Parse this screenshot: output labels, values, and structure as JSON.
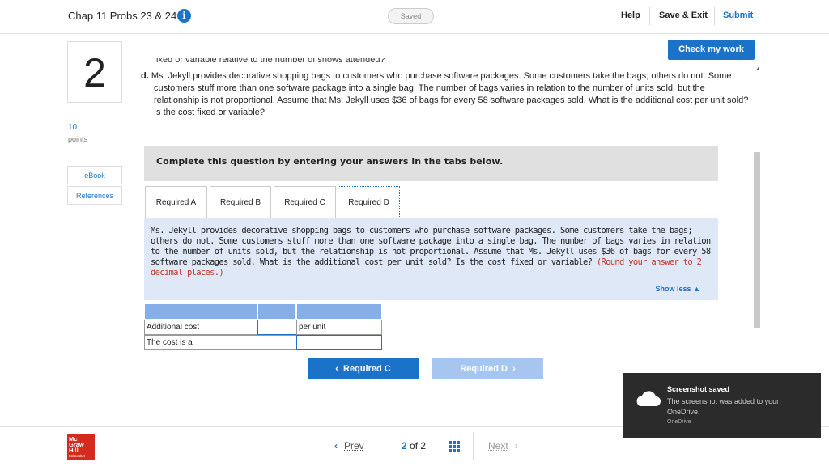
{
  "header": {
    "assignment_title": "Chap 11 Probs 23 & 24",
    "info_icon": "info-icon",
    "saved_status": "Saved",
    "help": "Help",
    "save_exit": "Save & Exit",
    "submit": "Submit",
    "check_my_work": "Check my work"
  },
  "question": {
    "number": "2",
    "points_value": "10",
    "points_label": "points",
    "ebook": "eBook",
    "references": "References",
    "cut_off_text": "fixed or variable relative to the number of shows attended?",
    "part_label": "d.",
    "part_text": "Ms. Jekyll provides decorative shopping bags to customers who purchase software packages. Some customers take the bags; others do not. Some customers stuff more than one software package into a single bag. The number of bags varies in relation to the number of units sold, but the relationship is not proportional. Assume that Ms. Jekyll uses $36 of bags for every 58 software packages sold. What is the additional cost per unit sold? Is the cost fixed or variable?"
  },
  "answer_area": {
    "instruction": "Complete this question by entering your answers in the tabs below.",
    "tabs": [
      "Required A",
      "Required B",
      "Required C",
      "Required D"
    ],
    "active_tab": "Required D",
    "panel_text": "Ms. Jekyll provides decorative shopping bags to customers who purchase software packages. Some customers take the bags; others do not. Some customers stuff more than one software package into a single bag. The number of bags varies in relation to the number of units sold, but the relationship is not proportional. Assume that Ms. Jekyll uses $36 of bags for every 58 software packages sold. What is the additional cost per unit sold? Is the cost fixed or variable?",
    "panel_note": "(Round your answer to 2 decimal places.)",
    "show_less": "Show less",
    "rows": [
      {
        "label": "Additional cost",
        "value": "",
        "unit": "per unit"
      },
      {
        "label": "The cost is a",
        "value": ""
      }
    ],
    "prev_tab_button": "Required C",
    "next_tab_button": "Required D"
  },
  "footer": {
    "logo_lines": [
      "Mc",
      "Graw",
      "Hill",
      "Education"
    ],
    "prev": "Prev",
    "current_page": "2",
    "of": "of",
    "total_pages": "2",
    "next": "Next"
  },
  "toast": {
    "title": "Screenshot saved",
    "body": "The screenshot was added to your OneDrive.",
    "source": "OneDrive",
    "icon": "cloud-icon"
  },
  "colors": {
    "accent": "#1a73c9",
    "disabled_accent": "#a6c6f0",
    "table_header": "#86aee8",
    "panel_bg": "#dfe8f7",
    "note_red": "#c0392b",
    "logo_red": "#d52b1e"
  }
}
